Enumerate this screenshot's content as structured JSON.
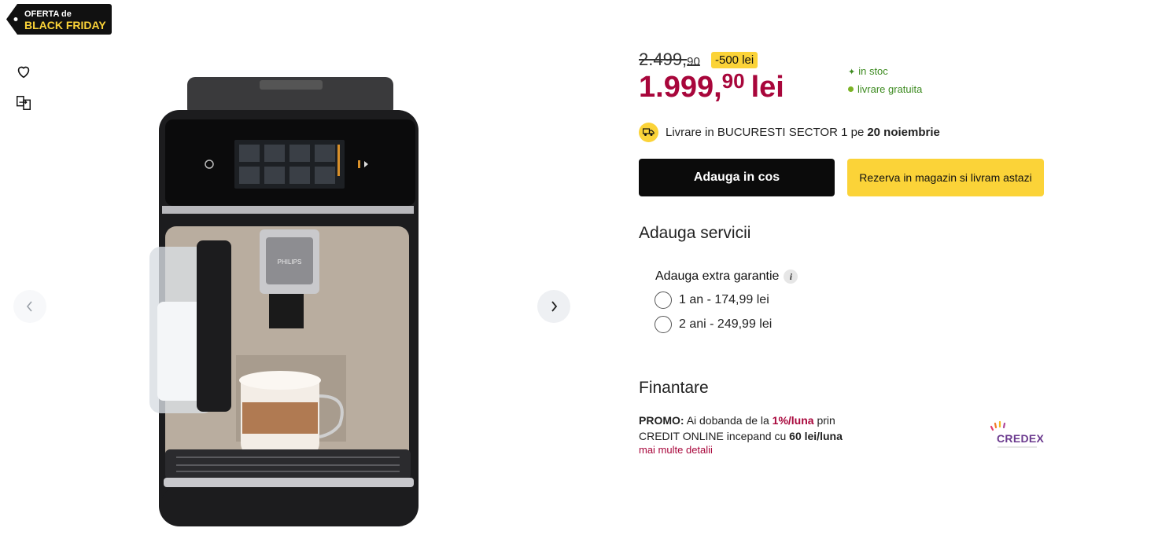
{
  "badge": {
    "line1": "OFERTA de",
    "line2": "BLACK FRIDAY"
  },
  "icons": {
    "favorite": "heart-icon",
    "compare": "compare-icon",
    "prev": "chevron-left-icon",
    "next": "chevron-right-icon"
  },
  "product": {
    "image_brand": "PHILIPS"
  },
  "price": {
    "old_int": "2.499,",
    "old_dec": "90",
    "discount": "-500 lei",
    "new_int": "1.999,",
    "new_dec": "90",
    "currency": "lei"
  },
  "availability": {
    "stock": "in stoc",
    "delivery": "livrare gratuita"
  },
  "shipping": {
    "text": "Livrare in BUCURESTI SECTOR 1 pe",
    "date": "20 noiembrie"
  },
  "actions": {
    "add_to_cart": "Adauga in cos",
    "reserve": "Rezerva in magazin si livram astazi"
  },
  "services": {
    "title": "Adauga servicii",
    "warranty_title": "Adauga extra garantie",
    "info": "i",
    "options": [
      {
        "label": "1 an - 174,99 lei"
      },
      {
        "label": "2 ani - 249,99 lei"
      }
    ]
  },
  "finance": {
    "title": "Finantare",
    "promo_label": "PROMO:",
    "promo_text1": "Ai dobanda de la",
    "rate": "1%/luna",
    "promo_text2": "prin",
    "promo_text3": "CREDIT ONLINE incepand cu",
    "min_payment": "60 lei/luna",
    "details_link": "mai multe detalii",
    "partner": "CREDEX"
  },
  "colors": {
    "accent": "#a8063b",
    "yellow": "#fbd338",
    "green": "#3c8a1f",
    "black": "#0b0b0b"
  }
}
